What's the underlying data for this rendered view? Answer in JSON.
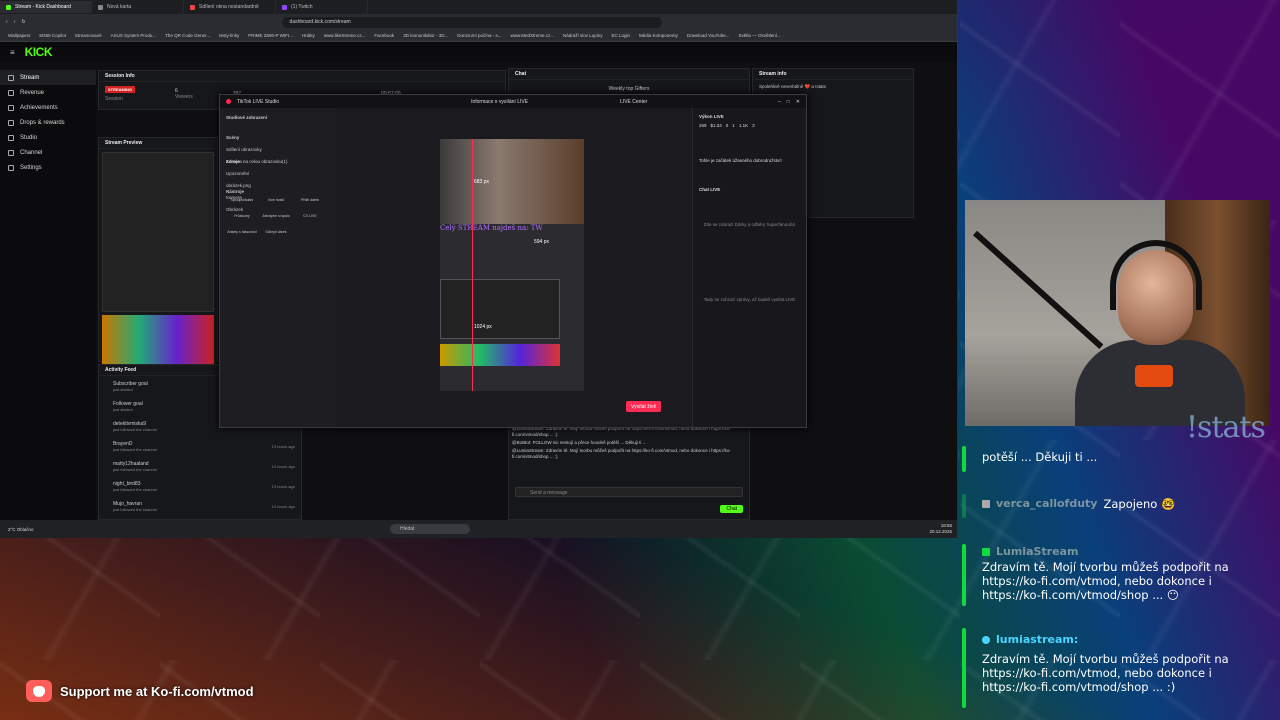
{
  "browser": {
    "tabs": [
      "Stream - Kick Dashboard",
      "Nová karta",
      "Sdílení okna nestandardně",
      "(1) Twitch"
    ],
    "url": "dashboard.kick.com/stream",
    "bookmarks": [
      "Wallpapers",
      "M365 Copilot",
      "Streamované",
      "ASUS System Produ...",
      "The QR Code Gener...",
      "testy-linky",
      "PRIME Z690-P WIFI...",
      "Hrátky",
      "www.likeXtreme.cz...",
      "Facebook",
      "3D komunikátor - 3D...",
      "Dorozumí počína - s...",
      "www.MedXtreme.cz...",
      "Nádraží slov Lupiny",
      "EC Login",
      "Média Komponenty",
      "Download YouTube...",
      "Světlo — Osvětlení..."
    ]
  },
  "kick": {
    "logo": "KICK",
    "sidebar": [
      "Stream",
      "Revenue",
      "Achievements",
      "Drops & rewards",
      "Studio",
      "Channel",
      "Settings"
    ],
    "session": {
      "title": "Session Info",
      "badge": "STREAMING",
      "session_label": "Session",
      "viewers_label": "Viewers",
      "viewers": "6",
      "followers": "387",
      "time": "00:57:00"
    },
    "preview_title": "Stream Preview",
    "chat_title": "Chat",
    "gifters_title": "Weekly top Gifters",
    "stream_info_title": "Stream info",
    "stream_info_subtitle": "Spolehlivě neverbálně ❤️ a !stats",
    "activity_title": "Activity Feed",
    "activity": [
      {
        "name": "Subscriber goal",
        "sub": "just started"
      },
      {
        "name": "Follower goal",
        "sub": "just started"
      },
      {
        "name": "detektivmiska9",
        "sub": "just followed the channel"
      },
      {
        "name": "BrayenD",
        "sub": "just followed the channel",
        "time": "13 hours ago"
      },
      {
        "name": "matty12haaland",
        "sub": "just followed the channel",
        "time": "13 hours ago"
      },
      {
        "name": "night_bird83",
        "sub": "just followed the channel",
        "time": "13 hours ago"
      },
      {
        "name": "Mujo_havran",
        "sub": "just followed the channel",
        "time": "13 hours ago"
      }
    ],
    "chat_input": "Send a message",
    "chat_button": "Chat",
    "mini_chat": [
      "@LumiaStream: Zdravím tě. Mojí tvorbu můžeš podpořit na https://ko-fi.com/vtmod, nebo dokonce i https://ko-fi.com/vtmod/shop ... :)",
      "@BotBot: FOLLOW nic nestojí a přece hoodně potěší ... Děkuji ti ...",
      "@LumiaStream: Zdravím tě. Mojí tvorbu můžeš podpořit na https://ko-fi.com/vtmod, nebo dokonce i https://ko-fi.com/vtmod/shop ... :)"
    ]
  },
  "tiktok": {
    "title": "TikTok LIVE Studio",
    "header": "Informace o vysílání LIVE",
    "live_center": "LIVE Center",
    "layout": "Studiové zobrazení",
    "scenes_label": "Scény",
    "scenes": [
      "Sdílení obrazovky",
      "Kamera na celou obrazovku(1)"
    ],
    "sources_label": "Zdroje",
    "sources": [
      "Upozornění",
      "obrázek.png",
      "Kamera",
      "Obrázek"
    ],
    "tools_label": "Nástroje",
    "tools": [
      "Spolupořádání",
      "Více hostů",
      "Příští dárek",
      "Průzkumy",
      "Zahrajme si spolu",
      "CX LIVE",
      "Ankety s hlasování",
      "Odkrytí dárek"
    ],
    "canvas_text": "Celý STREAM najdeš na: TW",
    "dim1": "683 px",
    "dim2": "594 px",
    "dim3": "1024 px",
    "go_live": "Vysílat živě",
    "right_title": "Výkon LIVE",
    "stats": [
      "269",
      "$1.04",
      "0",
      "1",
      "1.1K",
      "3"
    ],
    "right_hint": "Tohle je začátek úžasného dobrodružství!",
    "chat_live": "Chat LIVE",
    "empty_hint": "Zde se zobrazí Dárky a odběry Superfanoušci",
    "empty_hint2": "Tady se zobrazí zprávy, až budeš vysílat LIVE"
  },
  "taskbar": {
    "search": "Hledat",
    "weather": "2°C Oblačno",
    "time": "18:55",
    "date": "20.12.2025"
  },
  "overlay": {
    "stats_text": "!stats",
    "messages": [
      {
        "user": "",
        "text": "potěší ... Děkuji ti ..."
      },
      {
        "user": "verca_callofduty",
        "text": "Zapojeno 🤓",
        "faded": true
      },
      {
        "user": "LumiaStream",
        "text": "Zdravím tě. Mojí tvorbu můžeš podpořit na https://ko-fi.com/vtmod, nebo dokonce i https://ko-fi.com/vtmod/shop ... 😶",
        "faded": true
      },
      {
        "user": "lumiastream:",
        "text": "Zdravím tě. Mojí tvorbu můžeš podpořit na https://ko-fi.com/vtmod, nebo dokonce i https://ko-fi.com/vtmod/shop ... :)"
      }
    ],
    "kofi": "Support me at Ko-fi.com/vtmod"
  },
  "colors": {
    "kick_green": "#53fc18",
    "tiktok_red": "#fe2c55",
    "chat_border": "#0fdc3c",
    "username": "#47d7ff"
  }
}
